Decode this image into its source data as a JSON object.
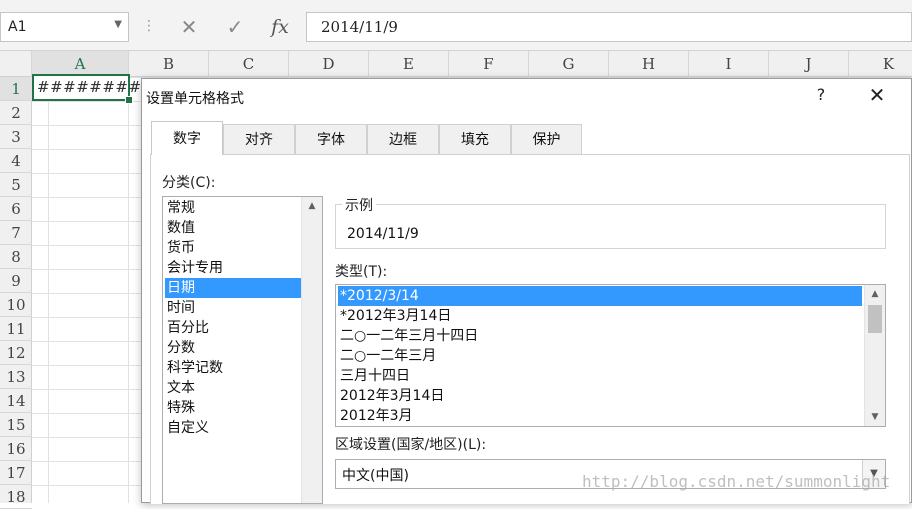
{
  "formula_bar": {
    "name_box": "A1",
    "cancel_icon": "✕",
    "enter_icon": "✓",
    "function_icon": "fx",
    "formula": "2014/11/9"
  },
  "grid": {
    "columns": [
      "A",
      "B",
      "C",
      "D",
      "E",
      "F",
      "G",
      "H",
      "I",
      "J",
      "K"
    ],
    "rows": [
      "1",
      "2",
      "3",
      "4",
      "5",
      "6",
      "7",
      "8",
      "9",
      "10",
      "11",
      "12",
      "13",
      "14",
      "15",
      "16",
      "17",
      "18"
    ],
    "cell_a1": "########"
  },
  "dialog": {
    "title": "设置单元格格式",
    "help": "?",
    "close": "✕",
    "tabs": [
      "数字",
      "对齐",
      "字体",
      "边框",
      "填充",
      "保护"
    ],
    "category_label": "分类(C):",
    "categories": [
      "常规",
      "数值",
      "货币",
      "会计专用",
      "日期",
      "时间",
      "百分比",
      "分数",
      "科学记数",
      "文本",
      "特殊",
      "自定义"
    ],
    "selected_category": "日期",
    "sample_label": "示例",
    "sample_value": "2014/11/9",
    "type_label": "类型(T):",
    "types": [
      "*2012/3/14",
      "*2012年3月14日",
      "二○一二年三月十四日",
      "二○一二年三月",
      "三月十四日",
      "2012年3月14日",
      "2012年3月"
    ],
    "selected_type": "*2012/3/14",
    "locale_label": "区域设置(国家/地区)(L):",
    "locale_value": "中文(中国)"
  },
  "watermark": "http://blog.csdn.net/summonlight",
  "colors": {
    "excel_green": "#217346",
    "selection_blue": "#3399ff"
  }
}
